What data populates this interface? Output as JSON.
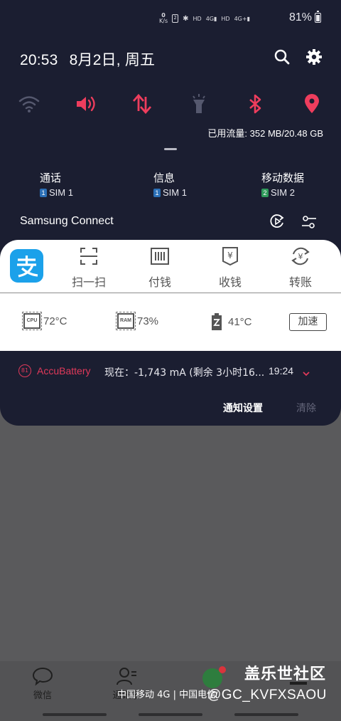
{
  "status_bar": {
    "speed_value": "0",
    "speed_unit": "K/s",
    "net1": "HD",
    "net1_type": "4G",
    "net2": "HD",
    "net2_type": "4G+",
    "battery_percent": "81%"
  },
  "header": {
    "time": "20:53",
    "date": "8月2日, 周五",
    "search_icon": "search-icon",
    "settings_icon": "gear-icon"
  },
  "quick_settings": [
    {
      "name": "wifi",
      "state": "off",
      "color": "#55586e"
    },
    {
      "name": "sound",
      "state": "on",
      "color": "#ee3d5d"
    },
    {
      "name": "mobile-data",
      "state": "on",
      "color": "#ee3d5d"
    },
    {
      "name": "flashlight",
      "state": "off",
      "color": "#55586e"
    },
    {
      "name": "bluetooth",
      "state": "on",
      "color": "#ee3d5d"
    },
    {
      "name": "location",
      "state": "on",
      "color": "#ee3d5d"
    }
  ],
  "data_usage": "已用流量: 352 MB/20.48 GB",
  "sim_settings": [
    {
      "title": "通话",
      "badge": "1",
      "sim": "SIM 1",
      "badge_color": "#2b6fb6"
    },
    {
      "title": "信息",
      "badge": "1",
      "sim": "SIM 1",
      "badge_color": "#2b6fb6"
    },
    {
      "title": "移动数据",
      "badge": "2",
      "sim": "SIM 2",
      "badge_color": "#2f9a5a"
    }
  ],
  "samsung_connect": {
    "title": "Samsung Connect"
  },
  "alipay": {
    "actions": [
      {
        "label": "扫一扫",
        "icon": "scan-icon"
      },
      {
        "label": "付钱",
        "icon": "barcode-icon"
      },
      {
        "label": "收钱",
        "icon": "receive-money-icon"
      },
      {
        "label": "转账",
        "icon": "transfer-icon"
      }
    ]
  },
  "monitor": {
    "cpu_label": "CPU",
    "cpu_temp": "72°C",
    "ram_label": "RAM",
    "ram_usage": "73%",
    "battery_temp": "41°C",
    "speed_up": "加速"
  },
  "accu_notification": {
    "icon_text": "81",
    "app": "AccuBattery",
    "text": "现在：-1,743 mA (剩余 3小时16...",
    "time": "19:24"
  },
  "notification_actions": {
    "settings": "通知设置",
    "clear": "清除"
  },
  "bottom": {
    "nav_items": [
      {
        "label": "微信",
        "icon": "chat-icon"
      },
      {
        "label": "通讯录",
        "icon": "contacts-icon"
      }
    ],
    "carrier": "中国移动 4G | 中国电信",
    "watermark_title": "盖乐世社区",
    "watermark_user": "@GC_KVFXSAOU"
  }
}
